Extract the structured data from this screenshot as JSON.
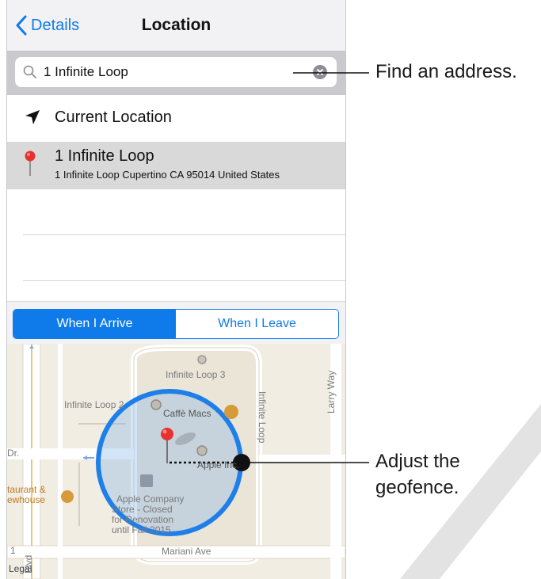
{
  "nav": {
    "back_label": "Details",
    "title": "Location"
  },
  "search": {
    "value": "1 Infinite Loop"
  },
  "results": {
    "current": "Current Location",
    "selected_title": "1 Infinite Loop",
    "selected_subtitle": "1 Infinite Loop Cupertino CA 95014 United States"
  },
  "segment": {
    "arrive": "When I Arrive",
    "leave": "When I Leave",
    "selected": "When I Arrive"
  },
  "map_labels": {
    "infinite_loop_3": "Infinite Loop 3",
    "infinite_loop_2": "Infinite Loop 2",
    "caffe": "Caffè Macs",
    "infinite_loop_vertical": "Infinite Loop",
    "larry_way": "Larry Way",
    "apple_inc": "Apple Inc.",
    "dr": "Dr.",
    "restaurant_1": "taurant &",
    "restaurant_2": "ewhouse",
    "store_1": "Apple Company",
    "store_2": "Store - Closed",
    "store_3": "for Renovation",
    "store_4": "until Fall 2015",
    "mariani": "Mariani Ave",
    "blvd": "Blvd",
    "legal": "Legal",
    "num_1": "1"
  },
  "callouts": {
    "find": "Find an address.",
    "adjust_1": "Adjust the",
    "adjust_2": "geofence."
  },
  "colors": {
    "accent": "#0f7aea",
    "pin": "#e8302e",
    "geofence": "#1e7fe8"
  }
}
